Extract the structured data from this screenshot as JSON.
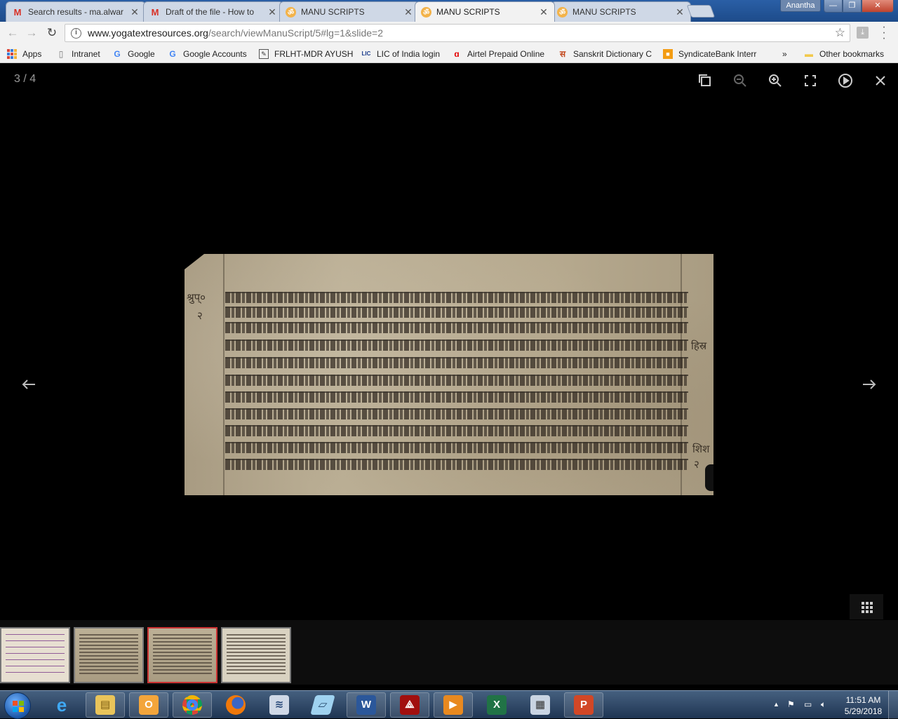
{
  "browser": {
    "tabs": [
      {
        "title": "Search results - ma.alwar",
        "icon": "gmail-icon",
        "active": false
      },
      {
        "title": "Draft of the file - How to",
        "icon": "gmail-icon",
        "active": false
      },
      {
        "title": "MANU SCRIPTS",
        "icon": "om-icon",
        "active": false
      },
      {
        "title": "MANU SCRIPTS",
        "icon": "om-icon",
        "active": true
      },
      {
        "title": "MANU SCRIPTS",
        "icon": "om-icon",
        "active": false
      }
    ],
    "profile_name": "Anantha",
    "url_host": "www.yogatextresources.org",
    "url_path": "/search/viewManuScript/5#lg=1&slide=2",
    "bookmarks": [
      {
        "label": "Apps",
        "icon": "apps-grid-icon"
      },
      {
        "label": "Intranet",
        "icon": "page-icon"
      },
      {
        "label": "Google",
        "icon": "google-icon"
      },
      {
        "label": "Google Accounts",
        "icon": "google-icon"
      },
      {
        "label": "FRLHT-MDR AYUSH",
        "icon": "frlht-icon"
      },
      {
        "label": "LIC of India login",
        "icon": "lic-icon"
      },
      {
        "label": "Airtel Prepaid Online",
        "icon": "airtel-icon"
      },
      {
        "label": "Sanskrit Dictionary C",
        "icon": "sanskrit-icon"
      },
      {
        "label": "SyndicateBank Interr",
        "icon": "syndicate-icon"
      }
    ],
    "bookmarks_overflow": "»",
    "other_bookmarks": "Other bookmarks"
  },
  "viewer": {
    "counter": "3 / 4",
    "toolbar": [
      "copy-icon",
      "zoom-out-icon",
      "zoom-in-icon",
      "fullscreen-icon",
      "autoplay-icon",
      "close-icon"
    ],
    "margin_left_top": "श्रुप्०",
    "margin_left_num": "२",
    "margin_right_top": "हिस्र",
    "margin_right_mid": "शिश",
    "margin_right_num": "२",
    "thumbnails": [
      {
        "index": 1,
        "active": false
      },
      {
        "index": 2,
        "active": false
      },
      {
        "index": 3,
        "active": true
      },
      {
        "index": 4,
        "active": false
      }
    ]
  },
  "taskbar": {
    "apps": [
      "internet-explorer-icon",
      "file-explorer-icon",
      "outlook-icon",
      "chrome-icon",
      "firefox-icon",
      "app-icon",
      "notepad-icon",
      "word-icon",
      "acrobat-icon",
      "media-player-icon",
      "excel-icon",
      "calculator-icon",
      "powerpoint-icon"
    ],
    "time": "11:51 AM",
    "date": "5/29/2018"
  }
}
